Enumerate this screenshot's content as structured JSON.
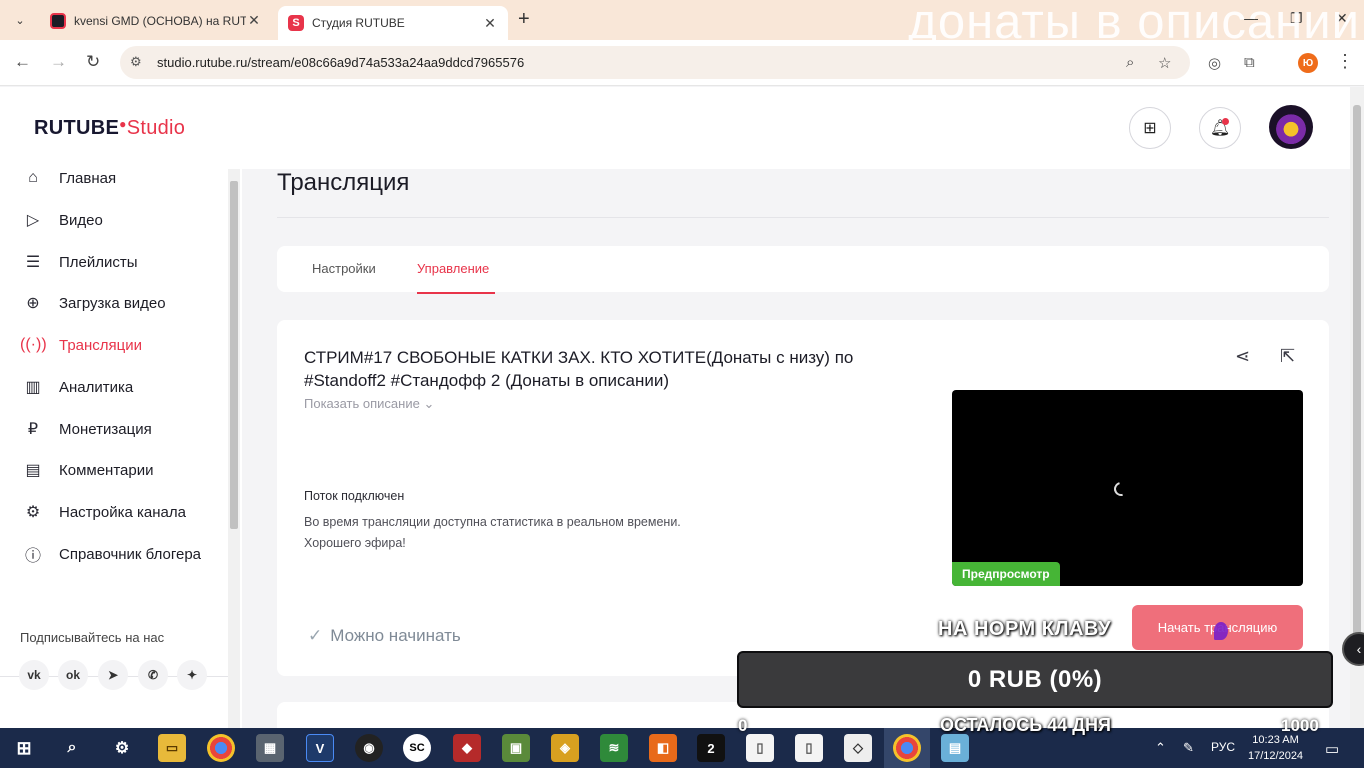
{
  "browser": {
    "tabs": [
      {
        "title": "kvensi GMD (OCHOBA) на RUTU",
        "favicon": "R"
      },
      {
        "title": "Студия RUTUBE",
        "favicon": "S"
      }
    ],
    "url": "studio.rutube.ru/stream/e08c66a9d74a533a24aa9ddcd7965576",
    "profile_initial": "Ю"
  },
  "overlay_text": "донаты в описании",
  "header": {
    "logo_main": "RUTUBE",
    "logo_studio": "Studio"
  },
  "sidebar": {
    "items": [
      {
        "label": "Главная",
        "icon": "home-icon",
        "active": false
      },
      {
        "label": "Видео",
        "icon": "video-icon",
        "active": false
      },
      {
        "label": "Плейлисты",
        "icon": "playlist-icon",
        "active": false
      },
      {
        "label": "Загрузка видео",
        "icon": "upload-icon",
        "active": false
      },
      {
        "label": "Трансляции",
        "icon": "broadcast-icon",
        "active": true
      },
      {
        "label": "Аналитика",
        "icon": "analytics-icon",
        "active": false
      },
      {
        "label": "Монетизация",
        "icon": "ruble-icon",
        "active": false
      },
      {
        "label": "Комментарии",
        "icon": "comment-icon",
        "active": false
      },
      {
        "label": "Настройка канала",
        "icon": "gear-icon",
        "active": false
      },
      {
        "label": "Справочник блогера",
        "icon": "info-icon",
        "active": false
      }
    ],
    "subscribe_label": "Подписывайтесь на нас",
    "socials": [
      "vk-icon",
      "ok-icon",
      "telegram-icon",
      "viber-icon",
      "zen-icon"
    ]
  },
  "main": {
    "page_title": "Трансляция",
    "tabs": [
      {
        "label": "Настройки",
        "active": false
      },
      {
        "label": "Управление",
        "active": true
      }
    ],
    "stream": {
      "title": "СТРИМ#17 СВОБОНЫЕ КАТКИ ЗАХ. КТО ХОТИТЕ(Донаты с низу) по #Standoff2 #Стандофф 2 (Донаты в описании)",
      "show_description": "Показать описание",
      "status": "Поток подключен",
      "note_line1": "Во время трансляции доступна статистика в реальном времени.",
      "note_line2": "Хорошего эфира!",
      "ready": "Можно начинать",
      "preview_badge": "Предпросмотр",
      "start_button": "Начать трансляцию"
    }
  },
  "donation_widget": {
    "goal_text": "НА НОРМ КЛАВУ",
    "amount": "0 RUB (0%)",
    "min": "0",
    "remaining": "ОСТАЛОСЬ 44 ДНЯ",
    "max": "1000",
    "progress": 0
  },
  "taskbar": {
    "language": "РУС",
    "time": "10:23 AM",
    "date": "17/12/2024"
  },
  "colors": {
    "accent": "#e8344a",
    "start_button": "#ef6f7b",
    "preview_badge": "#46b536",
    "taskbar": "#1b2a4a"
  }
}
